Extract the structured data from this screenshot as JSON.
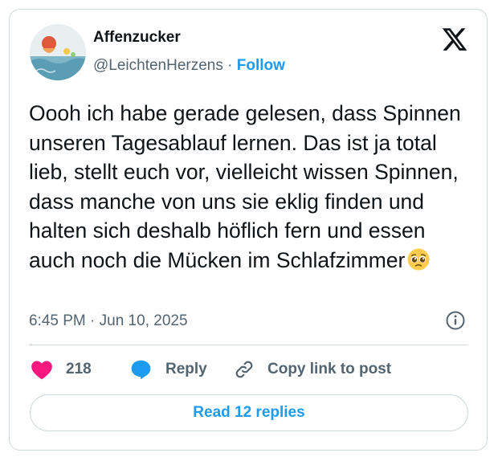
{
  "author": {
    "display_name": "Affenzucker",
    "handle": "@LeichtenHerzens",
    "separator": "·",
    "follow_label": "Follow"
  },
  "tweet": {
    "text": "Oooh ich habe gerade gelesen, dass Spinnen unseren Tagesablauf lernen. Das ist ja total lieb, stellt euch vor, vielleicht wissen Spinnen, dass manche von uns sie eklig finden und halten sich deshalb höflich fern und essen auch noch die Mücken im Schlafzimmer",
    "emoji": "pleading-face-icon",
    "timestamp": "6:45 PM · Jun 10, 2025"
  },
  "actions": {
    "like_count": "218",
    "reply_label": "Reply",
    "copy_link_label": "Copy link to post"
  },
  "read_replies_label": "Read 12 replies",
  "icons": [
    "x-logo-icon",
    "info-icon",
    "heart-icon",
    "reply-bubble-icon",
    "link-icon",
    "pleading-face-icon"
  ],
  "colors": {
    "accent": "#1d9bf0",
    "like": "#f91880",
    "text": "#0f1419",
    "secondary": "#536471",
    "border": "#cfd9de"
  }
}
